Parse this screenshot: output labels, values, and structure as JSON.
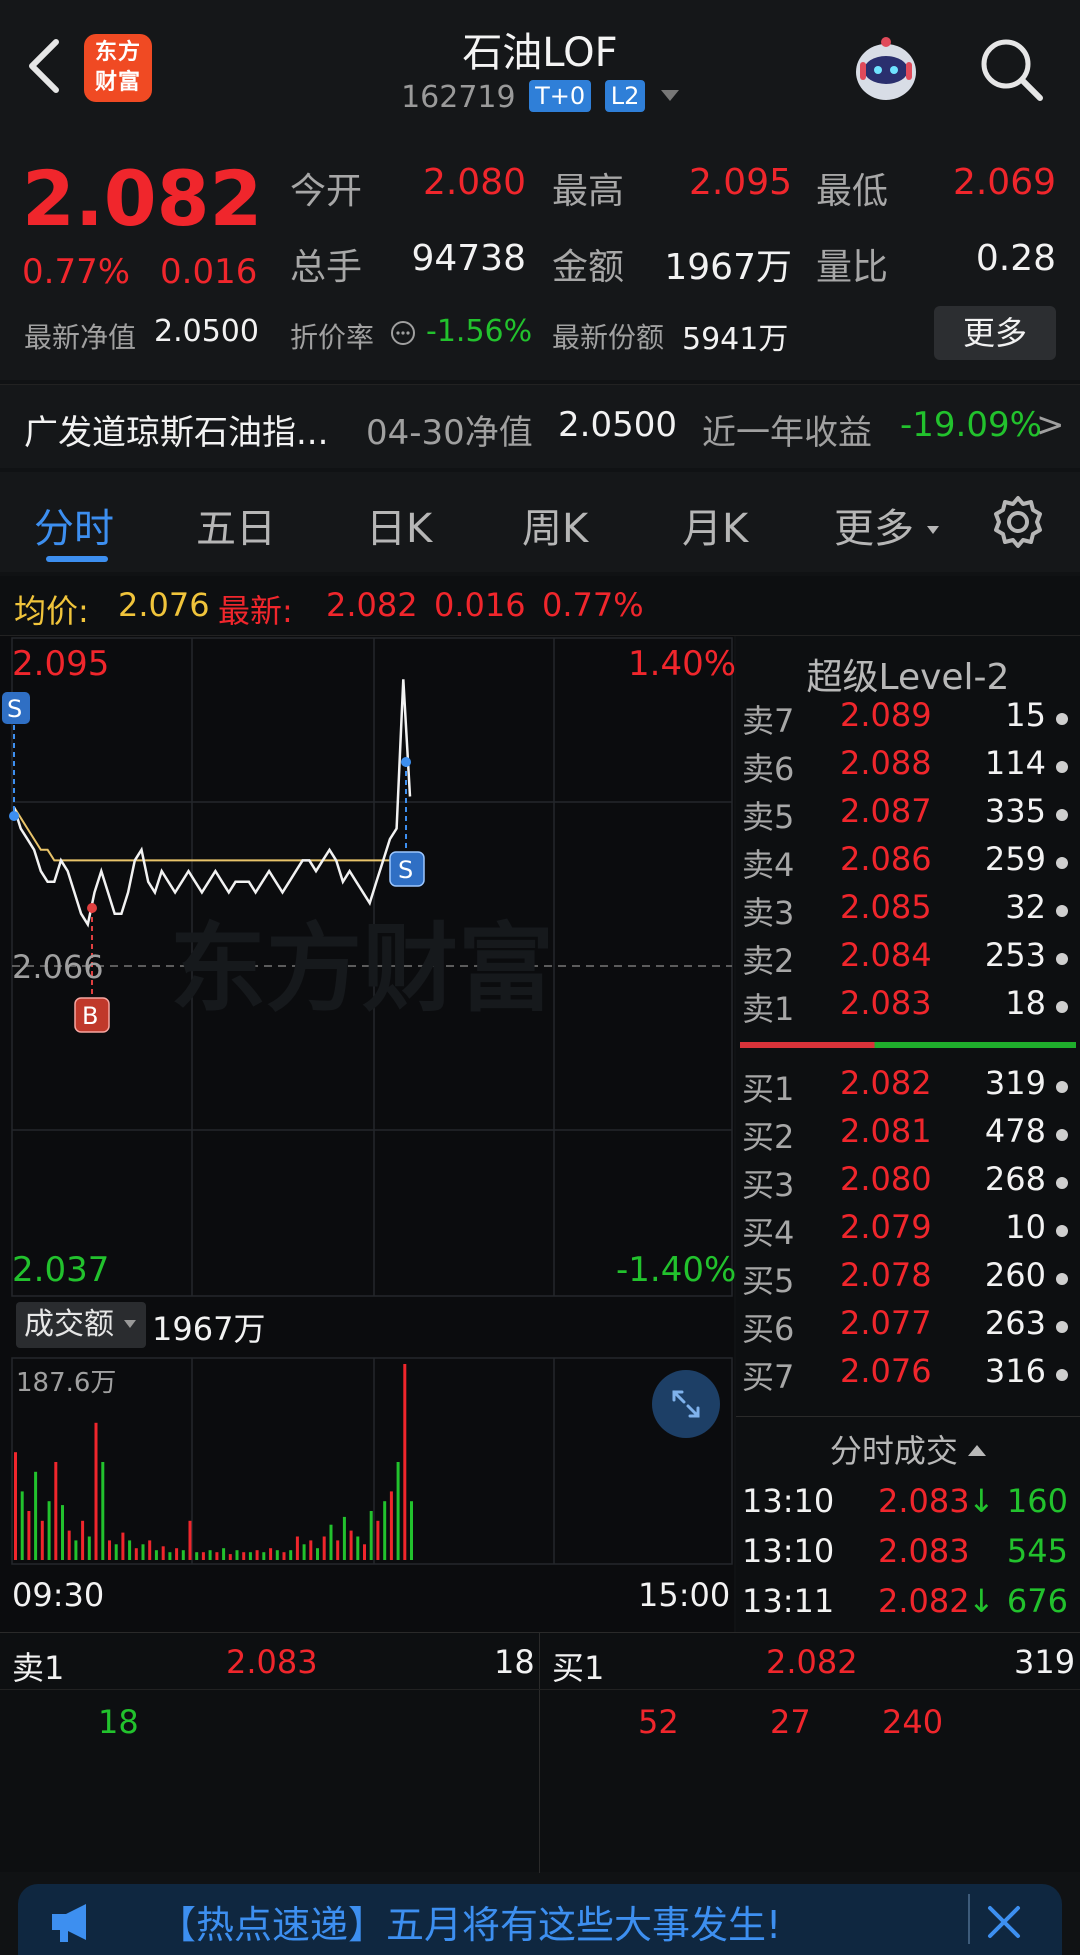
{
  "header": {
    "title": "石油LOF",
    "code": "162719",
    "tag1": "T+0",
    "tag2": "L2",
    "logo_line1": "东方",
    "logo_line2": "财富"
  },
  "quote": {
    "price": "2.082",
    "change_pct": "0.77%",
    "change": "0.016",
    "open_label": "今开",
    "open": "2.080",
    "high_label": "最高",
    "high": "2.095",
    "low_label": "最低",
    "low": "2.069",
    "volume_label": "总手",
    "volume": "94738",
    "amount_label": "金额",
    "amount": "1967万",
    "ratio_label": "量比",
    "ratio": "0.28",
    "nav_label": "最新净值",
    "nav": "2.0500",
    "discount_label": "折价率",
    "discount": "-1.56%",
    "shares_label": "最新份额",
    "shares": "5941万",
    "more_button": "更多"
  },
  "fund": {
    "name": "广发道琼斯石油指...",
    "nav_date_label": "04-30净值",
    "nav_value": "2.0500",
    "yearly_label": "近一年收益",
    "yearly_value": "-19.09%",
    "arrow": ">"
  },
  "tabs": [
    "分时",
    "五日",
    "日K",
    "周K",
    "月K",
    "更多"
  ],
  "avgline": {
    "avg_label": "均价:",
    "avg_value": "2.076",
    "latest_label": "最新:",
    "latest_value": "2.082",
    "latest_change": "0.016",
    "latest_pct": "0.77%"
  },
  "chart": {
    "top_price": "2.095",
    "bottom_price": "2.037",
    "top_pct": "1.40%",
    "bottom_pct": "-1.40%",
    "mid_price": "2.066",
    "watermark": "东方财富",
    "marker_s": "S",
    "marker_b": "B",
    "volume_selector": "成交额",
    "volume_total": "1967万",
    "volume_max": "187.6万",
    "time_start": "09:30",
    "time_end": "15:00"
  },
  "chart_data": {
    "type": "line",
    "title": "",
    "x_range": [
      "09:30",
      "15:00"
    ],
    "ylim": [
      2.037,
      2.095
    ],
    "price_series": [
      2.081,
      2.079,
      2.078,
      2.077,
      2.075,
      2.074,
      2.074,
      2.076,
      2.075,
      2.073,
      2.071,
      2.07,
      2.073,
      2.075,
      2.073,
      2.071,
      2.071,
      2.073,
      2.076,
      2.077,
      2.074,
      2.073,
      2.075,
      2.074,
      2.073,
      2.074,
      2.075,
      2.074,
      2.073,
      2.074,
      2.075,
      2.074,
      2.073,
      2.074,
      2.074,
      2.074,
      2.073,
      2.074,
      2.075,
      2.074,
      2.073,
      2.074,
      2.075,
      2.076,
      2.076,
      2.075,
      2.076,
      2.077,
      2.076,
      2.074,
      2.075,
      2.074,
      2.073,
      2.072,
      2.074,
      2.076,
      2.078,
      2.079,
      2.093,
      2.082
    ],
    "avg_series": [
      2.081,
      2.08,
      2.079,
      2.078,
      2.077,
      2.077,
      2.076,
      2.076,
      2.076,
      2.076,
      2.076,
      2.076,
      2.076,
      2.076,
      2.076,
      2.076,
      2.076,
      2.076,
      2.076,
      2.076,
      2.076,
      2.076,
      2.076,
      2.076,
      2.076,
      2.076,
      2.076,
      2.076,
      2.076,
      2.076,
      2.076,
      2.076,
      2.076,
      2.076,
      2.076,
      2.076,
      2.076,
      2.076,
      2.076,
      2.076,
      2.076,
      2.076,
      2.076,
      2.076,
      2.076,
      2.076,
      2.076,
      2.076,
      2.076,
      2.076,
      2.076,
      2.076,
      2.076,
      2.076,
      2.076,
      2.076,
      2.076,
      2.076,
      2.076,
      2.076
    ],
    "volume_series": [
      {
        "v": 0.55,
        "c": "r"
      },
      {
        "v": 0.35,
        "c": "g"
      },
      {
        "v": 0.25,
        "c": "r"
      },
      {
        "v": 0.45,
        "c": "g"
      },
      {
        "v": 0.2,
        "c": "r"
      },
      {
        "v": 0.3,
        "c": "g"
      },
      {
        "v": 0.5,
        "c": "r"
      },
      {
        "v": 0.28,
        "c": "g"
      },
      {
        "v": 0.15,
        "c": "r"
      },
      {
        "v": 0.1,
        "c": "g"
      },
      {
        "v": 0.2,
        "c": "r"
      },
      {
        "v": 0.12,
        "c": "g"
      },
      {
        "v": 0.7,
        "c": "r"
      },
      {
        "v": 0.5,
        "c": "g"
      },
      {
        "v": 0.1,
        "c": "r"
      },
      {
        "v": 0.08,
        "c": "g"
      },
      {
        "v": 0.14,
        "c": "r"
      },
      {
        "v": 0.1,
        "c": "g"
      },
      {
        "v": 0.06,
        "c": "r"
      },
      {
        "v": 0.08,
        "c": "g"
      },
      {
        "v": 0.1,
        "c": "r"
      },
      {
        "v": 0.05,
        "c": "g"
      },
      {
        "v": 0.07,
        "c": "r"
      },
      {
        "v": 0.04,
        "c": "g"
      },
      {
        "v": 0.06,
        "c": "r"
      },
      {
        "v": 0.05,
        "c": "g"
      },
      {
        "v": 0.2,
        "c": "r"
      },
      {
        "v": 0.04,
        "c": "g"
      },
      {
        "v": 0.04,
        "c": "r"
      },
      {
        "v": 0.05,
        "c": "g"
      },
      {
        "v": 0.04,
        "c": "r"
      },
      {
        "v": 0.06,
        "c": "g"
      },
      {
        "v": 0.03,
        "c": "r"
      },
      {
        "v": 0.05,
        "c": "g"
      },
      {
        "v": 0.04,
        "c": "r"
      },
      {
        "v": 0.04,
        "c": "g"
      },
      {
        "v": 0.05,
        "c": "r"
      },
      {
        "v": 0.04,
        "c": "g"
      },
      {
        "v": 0.06,
        "c": "r"
      },
      {
        "v": 0.05,
        "c": "g"
      },
      {
        "v": 0.04,
        "c": "r"
      },
      {
        "v": 0.05,
        "c": "g"
      },
      {
        "v": 0.12,
        "c": "r"
      },
      {
        "v": 0.08,
        "c": "g"
      },
      {
        "v": 0.1,
        "c": "r"
      },
      {
        "v": 0.06,
        "c": "g"
      },
      {
        "v": 0.12,
        "c": "r"
      },
      {
        "v": 0.18,
        "c": "g"
      },
      {
        "v": 0.1,
        "c": "r"
      },
      {
        "v": 0.22,
        "c": "g"
      },
      {
        "v": 0.15,
        "c": "r"
      },
      {
        "v": 0.12,
        "c": "g"
      },
      {
        "v": 0.08,
        "c": "r"
      },
      {
        "v": 0.25,
        "c": "g"
      },
      {
        "v": 0.2,
        "c": "r"
      },
      {
        "v": 0.3,
        "c": "g"
      },
      {
        "v": 0.35,
        "c": "r"
      },
      {
        "v": 0.5,
        "c": "g"
      },
      {
        "v": 1.0,
        "c": "r"
      },
      {
        "v": 0.3,
        "c": "g"
      }
    ]
  },
  "book": {
    "title": "超级Level-2",
    "asks": [
      {
        "label": "卖7",
        "price": "2.089",
        "vol": "15"
      },
      {
        "label": "卖6",
        "price": "2.088",
        "vol": "114"
      },
      {
        "label": "卖5",
        "price": "2.087",
        "vol": "335"
      },
      {
        "label": "卖4",
        "price": "2.086",
        "vol": "259"
      },
      {
        "label": "卖3",
        "price": "2.085",
        "vol": "32"
      },
      {
        "label": "卖2",
        "price": "2.084",
        "vol": "253"
      },
      {
        "label": "卖1",
        "price": "2.083",
        "vol": "18"
      }
    ],
    "bids": [
      {
        "label": "买1",
        "price": "2.082",
        "vol": "319"
      },
      {
        "label": "买2",
        "price": "2.081",
        "vol": "478"
      },
      {
        "label": "买3",
        "price": "2.080",
        "vol": "268"
      },
      {
        "label": "买4",
        "price": "2.079",
        "vol": "10"
      },
      {
        "label": "买5",
        "price": "2.078",
        "vol": "260"
      },
      {
        "label": "买6",
        "price": "2.077",
        "vol": "263"
      },
      {
        "label": "买7",
        "price": "2.076",
        "vol": "316"
      }
    ],
    "ticks_title": "分时成交",
    "ticks": [
      {
        "time": "13:10",
        "price": "2.083",
        "dir": "↓",
        "vol": "160"
      },
      {
        "time": "13:10",
        "price": "2.083",
        "dir": "",
        "vol": "545"
      },
      {
        "time": "13:11",
        "price": "2.082",
        "dir": "↓",
        "vol": "676"
      }
    ]
  },
  "level1": {
    "sell_label": "卖1",
    "sell_price": "2.083",
    "sell_vol": "18",
    "buy_label": "买1",
    "buy_price": "2.082",
    "buy_vol": "319",
    "sell_queue": [
      "18"
    ],
    "buy_queue": [
      "52",
      "27",
      "240"
    ]
  },
  "news": {
    "text": "【热点速递】五月将有这些大事发生!"
  },
  "colors": {
    "up": "#f0262c",
    "down": "#22c22d",
    "accent": "#3d8ff0",
    "avg": "#f0c43b"
  }
}
